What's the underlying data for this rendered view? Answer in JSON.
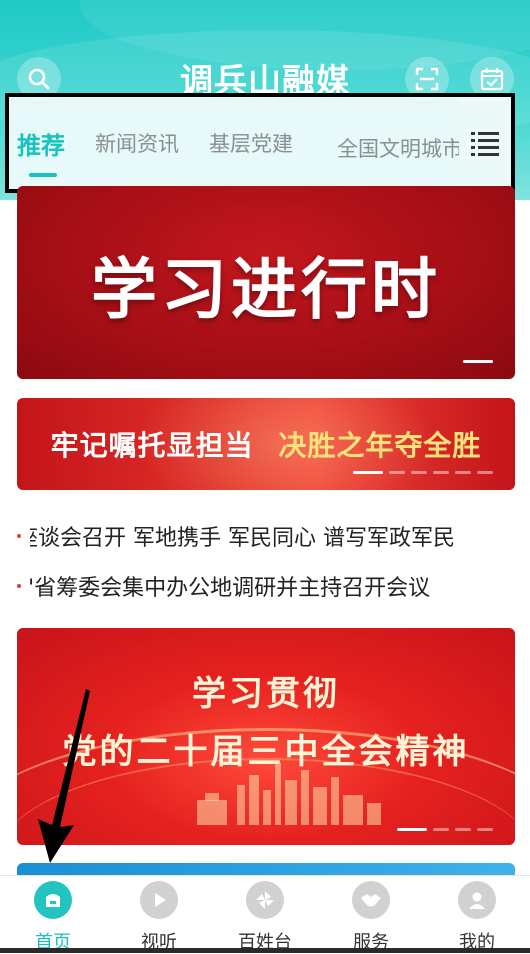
{
  "header": {
    "logo": "调兵山融媒",
    "colors": {
      "bg": "#20c9c6",
      "accent": "#18c3be",
      "logo_red": "#e03a3a"
    },
    "icons": [
      "search-icon",
      "scan-icon",
      "calendar-check-icon"
    ]
  },
  "tabs": [
    {
      "label": "推荐",
      "active": true
    },
    {
      "label": "新闻资讯",
      "active": false
    },
    {
      "label": "基层党建",
      "active": false
    },
    {
      "label": "全国文明城市",
      "active": false
    }
  ],
  "tabs_menu_icon": "list-menu-icon",
  "banners": {
    "b1": {
      "title": "学习进行时"
    },
    "b2": {
      "part1": "牢记嘱托显担当",
      "part2": "决胜之年夺全胜"
    },
    "b3": {
      "line1": "学习贯彻",
      "line2": "党的二十届三中全会精神"
    }
  },
  "ticker": [
    "座谈会召开 军地携手 军民同心 谱写军政军民",
    "\"省筹委会集中办公地调研并主持召开会议"
  ],
  "bottom_nav": [
    {
      "label": "首页",
      "icon": "home-icon",
      "active": true
    },
    {
      "label": "视听",
      "icon": "play-icon",
      "active": false
    },
    {
      "label": "百姓台",
      "icon": "pinwheel-icon",
      "active": false
    },
    {
      "label": "服务",
      "icon": "handshake-icon",
      "active": false
    },
    {
      "label": "我的",
      "icon": "user-icon",
      "active": false
    }
  ]
}
